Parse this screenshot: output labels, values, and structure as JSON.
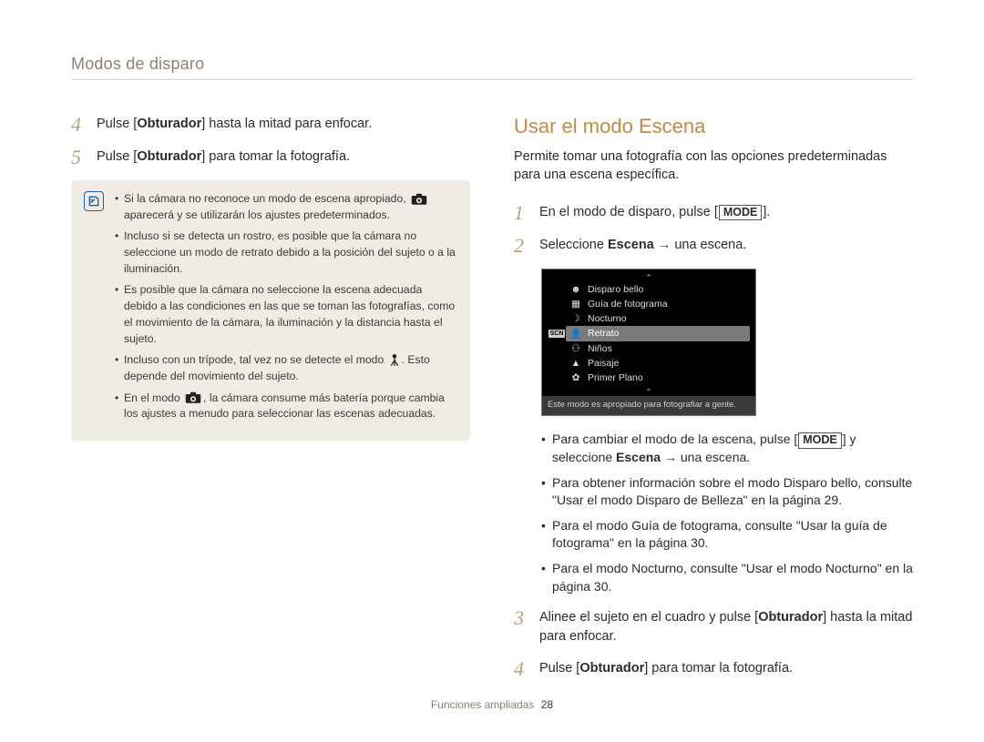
{
  "breadcrumb": "Modos de disparo",
  "left": {
    "steps": [
      {
        "num": "4",
        "text": "Pulse [<b>Obturador</b>] hasta la mitad para enfocar."
      },
      {
        "num": "5",
        "text": "Pulse [<b>Obturador</b>] para tomar la fotografía."
      }
    ],
    "notes": [
      "Si la cámara no reconoce un modo de escena apropiado, {camera} aparecerá y se utilizarán los ajustes predeterminados.",
      "Incluso si se detecta un rostro, es posible que la cámara no seleccione un modo de retrato debido a la posición del sujeto o a la iluminación.",
      "Es posible que la cámara no seleccione la escena adecuada debido a las condiciones en las que se toman las fotografías, como el movimiento de la cámara, la iluminación y la distancia hasta el sujeto.",
      "Incluso con un trípode, tal vez no se detecte el modo {tripod}. Esto depende del movimiento del sujeto.",
      "En el modo {camera}, la cámara consume más batería porque cambia los ajustes a menudo para seleccionar las escenas adecuadas."
    ]
  },
  "right": {
    "title": "Usar el modo Escena",
    "intro": "Permite tomar una fotografía con las opciones predeterminadas para una escena específica.",
    "step1": {
      "num": "1",
      "pre": "En el modo de disparo, pulse [",
      "btn": "MODE",
      "post": "]."
    },
    "step2": {
      "num": "2",
      "text": "Seleccione <b>Escena</b> → una escena."
    },
    "menu": {
      "badge": "SCN",
      "items": [
        {
          "label": "Disparo bello",
          "icon": "face"
        },
        {
          "label": "Guía de fotograma",
          "icon": "frame"
        },
        {
          "label": "Nocturno",
          "icon": "moon"
        },
        {
          "label": "Retrato",
          "icon": "person",
          "selected": true
        },
        {
          "label": "Niños",
          "icon": "baby"
        },
        {
          "label": "Paisaje",
          "icon": "mountain"
        },
        {
          "label": "Primer Plano",
          "icon": "flower"
        }
      ],
      "tip": "Este modo es apropiado para fotografiar a gente."
    },
    "sublist_pre": "Para cambiar el modo de la escena, pulse [",
    "sublist_btn": "MODE",
    "sublist_post": "] y seleccione <b>Escena</b> → una escena.",
    "sublist": [
      "Para obtener información sobre el modo Disparo bello, consulte \"Usar el modo Disparo de Belleza\" en la página 29.",
      "Para el modo Guía de fotograma, consulte \"Usar la guía de fotograma\" en la página 30.",
      "Para el modo Nocturno, consulte \"Usar el modo Nocturno\" en la página 30."
    ],
    "step3": {
      "num": "3",
      "text": "Alinee el sujeto en el cuadro y pulse [<b>Obturador</b>] hasta la mitad para enfocar."
    },
    "step4": {
      "num": "4",
      "text": "Pulse [<b>Obturador</b>] para tomar la fotografía."
    }
  },
  "footer": {
    "section": "Funciones ampliadas",
    "page": "28"
  }
}
